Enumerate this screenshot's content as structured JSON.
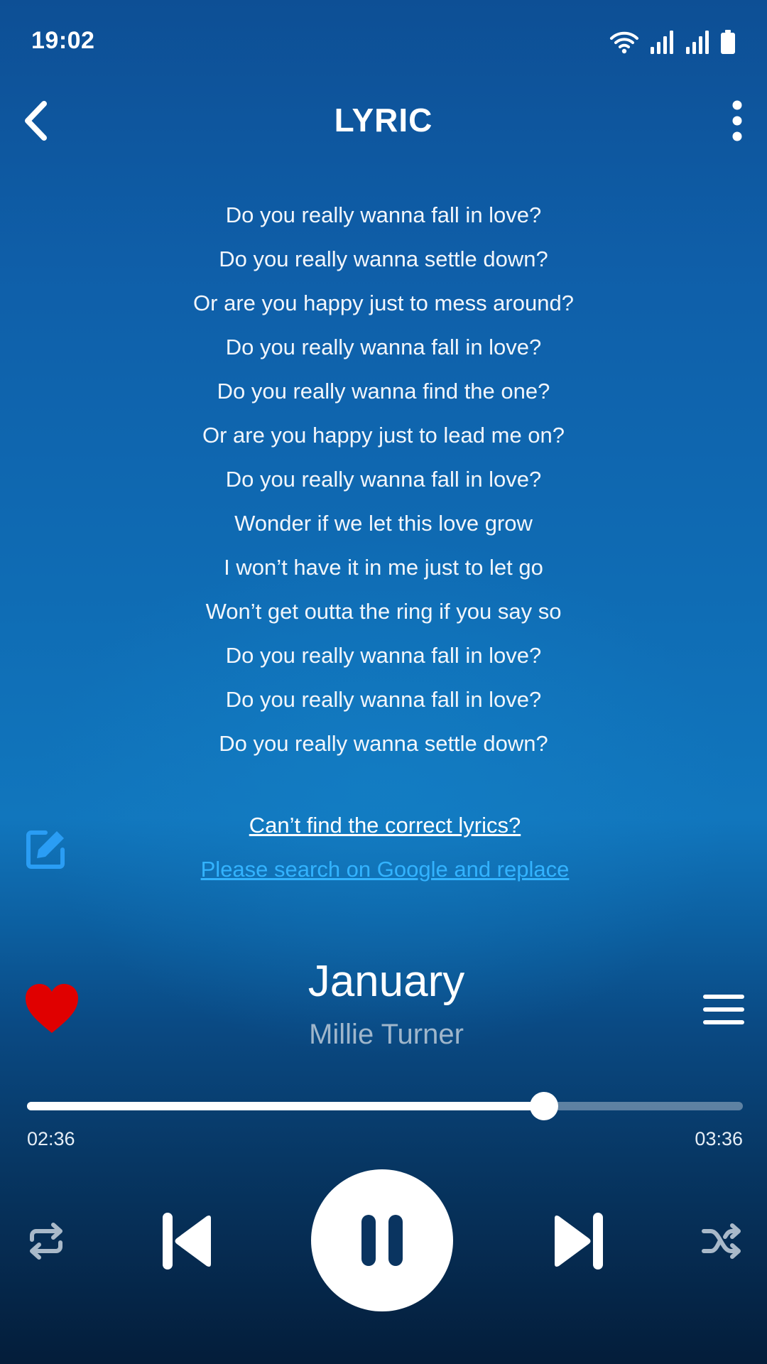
{
  "status_bar": {
    "time": "19:02",
    "icons": [
      "wifi-icon",
      "signal-icon",
      "signal-icon",
      "battery-icon"
    ]
  },
  "header": {
    "title": "LYRIC",
    "back_icon": "chevron-left-icon",
    "menu_icon": "more-vertical-icon"
  },
  "lyrics": [
    "Do you really wanna fall in love?",
    "Do you really wanna settle down?",
    "Or are you happy just to mess around?",
    "Do you really wanna fall in love?",
    "Do you really wanna find the one?",
    "Or are you happy just to lead me on?",
    "Do you really wanna fall in love?",
    "Wonder if we let this love grow",
    "I won’t have it in me just to let go",
    "Won’t get outta the ring if you say so",
    "Do you really wanna fall in love?",
    "Do you really wanna fall in love?",
    "Do you really wanna settle down?"
  ],
  "lyrics_help": {
    "question": "Can’t find the correct lyrics?",
    "action": "Please search on Google and replace",
    "edit_icon": "edit-icon"
  },
  "now_playing": {
    "title": "January",
    "artist": "Millie Turner",
    "liked": true,
    "favorite_icon": "heart-icon",
    "queue_icon": "queue-icon"
  },
  "progress": {
    "elapsed": "02:36",
    "total": "03:36",
    "fraction": 0.722
  },
  "controls": {
    "repeat_icon": "repeat-icon",
    "previous_icon": "skip-previous-icon",
    "play_pause_icon": "pause-icon",
    "next_icon": "skip-next-icon",
    "shuffle_icon": "shuffle-icon"
  },
  "colors": {
    "accent_link": "#33b3ff",
    "heart": "#e00000",
    "edit_icon": "#2a9df4"
  }
}
